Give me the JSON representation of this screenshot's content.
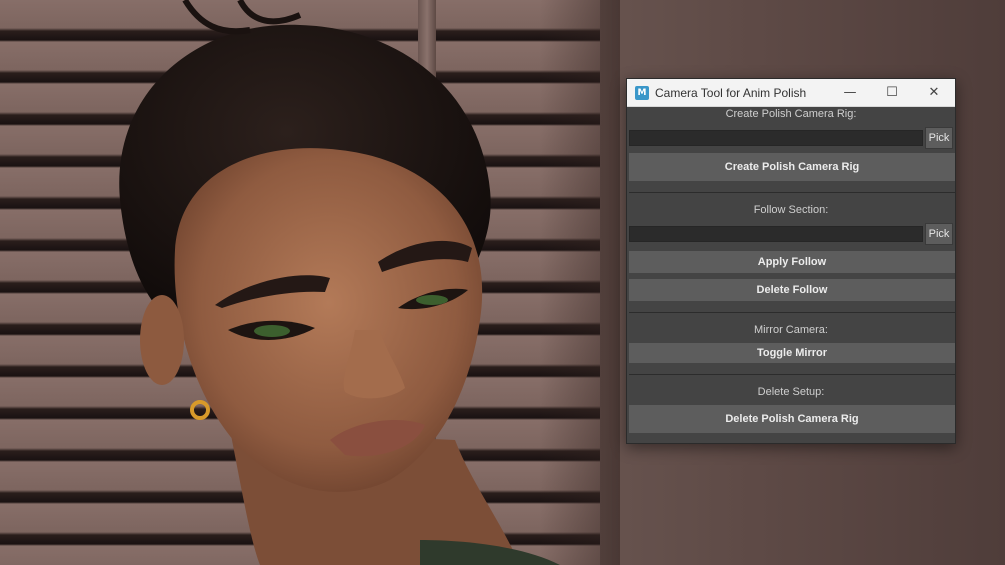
{
  "window": {
    "title": "Camera Tool for Anim Polish",
    "app_icon_letter": "M",
    "controls": {
      "minimize": "—",
      "maximize": "☐",
      "close": "✕"
    }
  },
  "rig_section": {
    "label": "Create Polish Camera Rig:",
    "field_value": "",
    "pick_label": "Pick",
    "create_button": "Create Polish Camera Rig"
  },
  "follow_section": {
    "label": "Follow Section:",
    "field_value": "",
    "pick_label": "Pick",
    "apply_button": "Apply Follow",
    "delete_button": "Delete Follow"
  },
  "mirror_section": {
    "label": "Mirror Camera:",
    "toggle_button": "Toggle Mirror"
  },
  "delete_section": {
    "label": "Delete Setup:",
    "delete_button": "Delete Polish Camera Rig"
  },
  "colors": {
    "panel_bg": "#444444",
    "button_bg": "#5d5d5d",
    "field_bg": "#2b2b2b",
    "titlebar_bg": "#f3f3f3",
    "app_icon": "#3a97c9"
  }
}
